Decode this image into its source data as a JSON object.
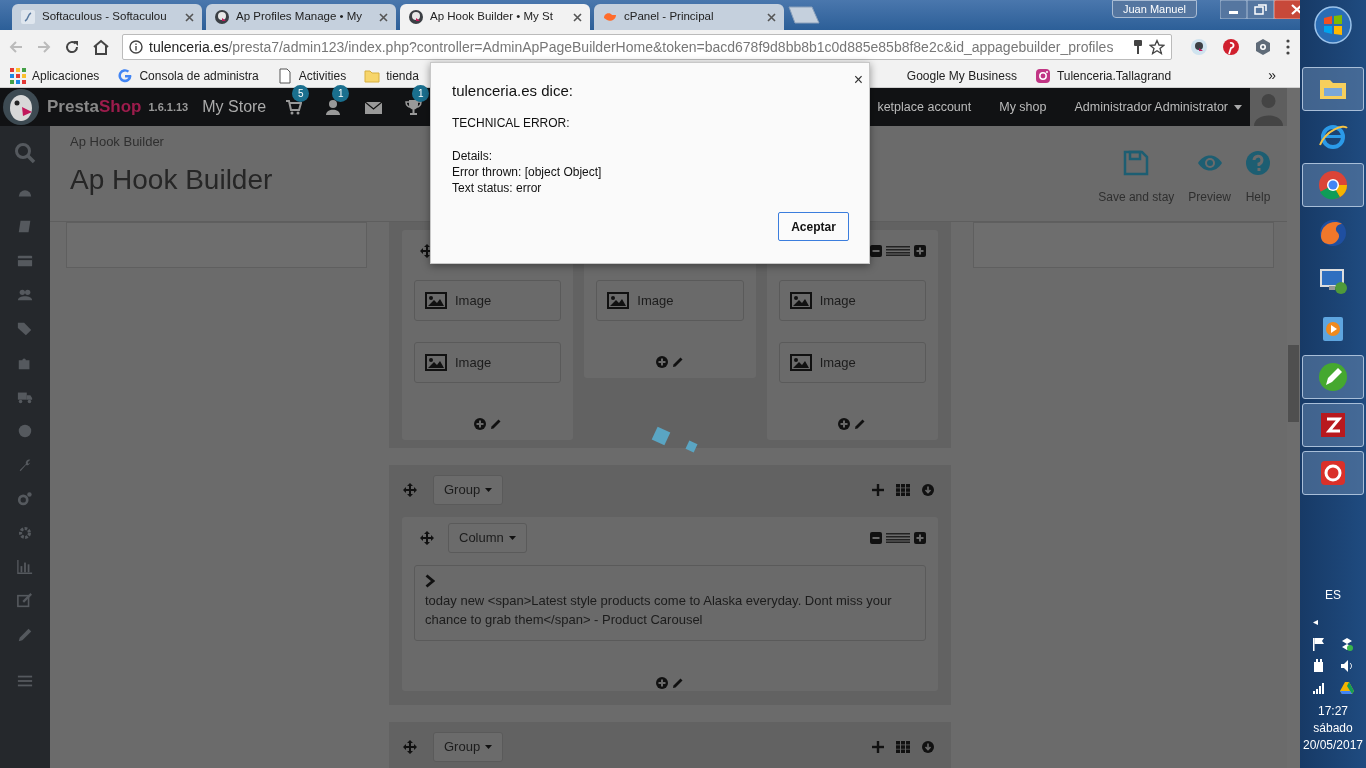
{
  "browser": {
    "tabs": [
      {
        "title": "Softaculous - Softaculou",
        "selected": false
      },
      {
        "title": "Ap Profiles Manage • My",
        "selected": false
      },
      {
        "title": "Ap Hook Builder • My St",
        "selected": true
      },
      {
        "title": "cPanel - Principal",
        "selected": false
      }
    ],
    "user": "Juan Manuel",
    "address": {
      "domain": "tulenceria.es",
      "path": "/presta7/admin123/index.php?controller=AdminApPageBuilderHome&token=bacd678f9d8bb8b1c0d885e85b8f8e2c&id_appagebuilder_profiles"
    },
    "bookmarks": [
      "Aplicaciones",
      "Consola de administra",
      "Activities",
      "tienda",
      "Google My Business",
      "Tulenceria.Tallagrand"
    ],
    "bookmarks_overflow": "»"
  },
  "nav": {
    "brand": {
      "first": "Presta",
      "second": "Shop"
    },
    "version": "1.6.1.13",
    "store": "My Store",
    "badges": [
      "5",
      "1",
      "1"
    ],
    "links": [
      "ketplace account",
      "My shop"
    ],
    "admin": "Administrador Administrator"
  },
  "header": {
    "breadcrumb": "Ap Hook Builder",
    "title": "Ap Hook Builder",
    "actions": [
      "Save and stay",
      "Preview",
      "Help"
    ]
  },
  "builder": {
    "groups": [
      {
        "columns": [
          {
            "move": true,
            "tools": false,
            "widgets": [
              {
                "kind": "image",
                "label": "Image"
              },
              {
                "kind": "image",
                "label": "Image"
              }
            ]
          },
          {
            "move": false,
            "tools": false,
            "widgets": [
              {
                "kind": "image",
                "label": "Image"
              }
            ]
          },
          {
            "move": false,
            "tools": true,
            "widgets": [
              {
                "kind": "image",
                "label": "Image"
              },
              {
                "kind": "image",
                "label": "Image"
              }
            ]
          }
        ]
      },
      {
        "button": "Group",
        "columns": [
          {
            "move": true,
            "tools": true,
            "button": "Column",
            "widgets": [
              {
                "kind": "text",
                "label": "today new <span>Latest style products come to Alaska everyday. Dont miss your chance to grab them</span> - Product Carousel"
              }
            ]
          }
        ]
      },
      {
        "button": "Group"
      }
    ]
  },
  "dialog": {
    "title": "tulenceria.es dice:",
    "close": "×",
    "paragraphs": [
      [
        "TECHNICAL ERROR:"
      ],
      [
        "Details:",
        "Error thrown: [object Object]",
        "Text status: error"
      ]
    ],
    "button": "Aceptar"
  },
  "taskbar": {
    "apps": [
      {
        "running": true
      },
      {
        "running": false
      },
      {
        "running": true
      },
      {
        "running": false
      },
      {
        "running": false
      },
      {
        "running": false
      },
      {
        "running": true
      },
      {
        "running": true
      },
      {
        "running": true
      }
    ],
    "language": "ES",
    "tray_arrow": "◂",
    "time": "17:27",
    "day": "sábado",
    "date": "20/05/2017"
  }
}
